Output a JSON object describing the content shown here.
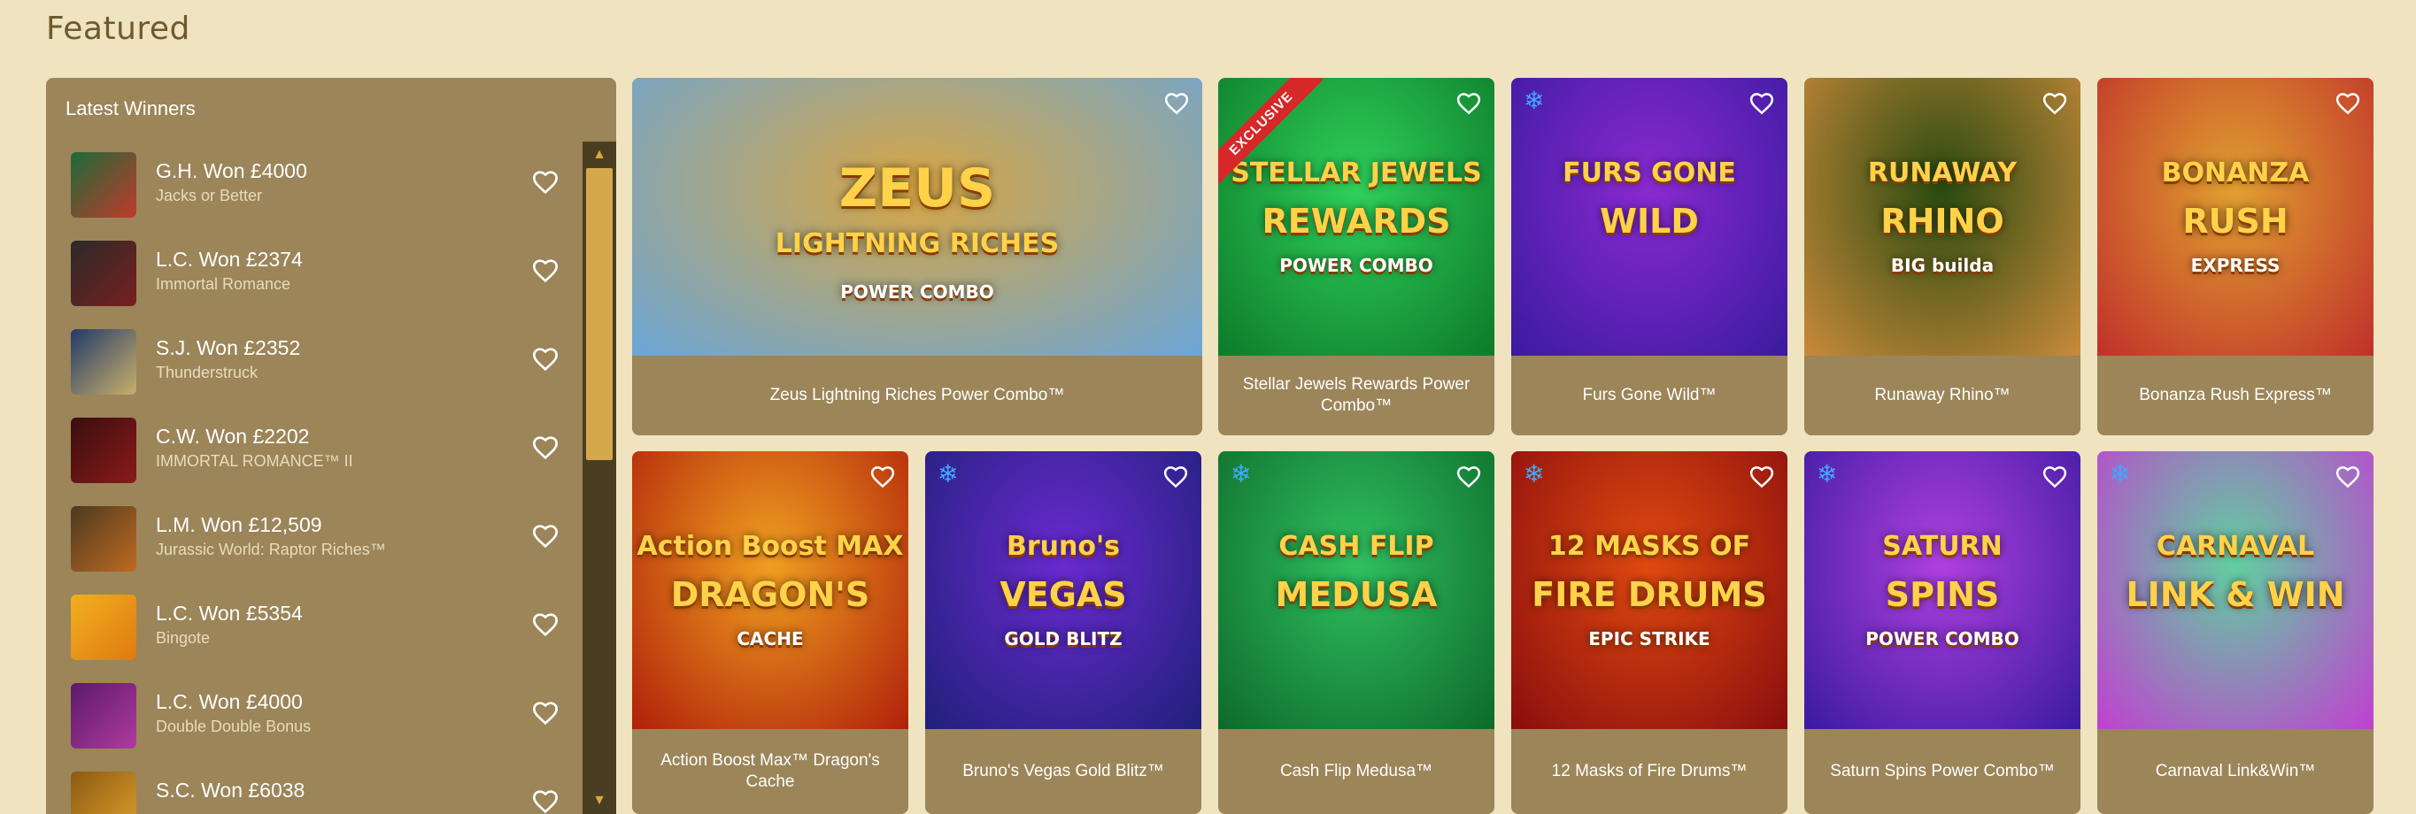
{
  "section": {
    "title": "Featured"
  },
  "winners": {
    "title": "Latest Winners",
    "items": [
      {
        "name": "G.H. Won £4000",
        "game": "Jacks or Better",
        "colors": [
          "#1a6b3a",
          "#c23a2a"
        ]
      },
      {
        "name": "L.C. Won £2374",
        "game": "Immortal Romance",
        "colors": [
          "#2a2a2a",
          "#7a1f1f"
        ]
      },
      {
        "name": "S.J. Won £2352",
        "game": "Thunderstruck",
        "colors": [
          "#223a6a",
          "#c9b06a"
        ]
      },
      {
        "name": "C.W. Won £2202",
        "game": "IMMORTAL ROMANCE™ II",
        "colors": [
          "#3a0e0e",
          "#8a1a1a"
        ]
      },
      {
        "name": "L.M. Won £12,509",
        "game": "Jurassic World: Raptor Riches™",
        "colors": [
          "#4a3a20",
          "#c06a20"
        ]
      },
      {
        "name": "L.C. Won £5354",
        "game": "Bingote",
        "colors": [
          "#f0b020",
          "#e07a10"
        ]
      },
      {
        "name": "L.C. Won £4000",
        "game": "Double Double Bonus",
        "colors": [
          "#5a1a6a",
          "#b03aa0"
        ]
      },
      {
        "name": "S.C. Won £6038",
        "game": "",
        "colors": [
          "#8a5a10",
          "#e0a030"
        ]
      }
    ]
  },
  "games": [
    {
      "title": "Zeus Lightning Riches Power Combo™",
      "logo": "ZEUS",
      "logo2": "LIGHTNING RICHES",
      "logo3": "POWER COMBO",
      "bg": [
        "#6aa6d8",
        "#d9a642"
      ],
      "snow": false,
      "exclusive": false
    },
    {
      "title": "Stellar Jewels Rewards Power Combo™",
      "logo": "STELLAR JEWELS",
      "logo2": "REWARDS",
      "logo3": "POWER COMBO",
      "bg": [
        "#0d7a2a",
        "#2fd05a"
      ],
      "snow": false,
      "exclusive": true,
      "exclusive_label": "EXCLUSIVE"
    },
    {
      "title": "Furs Gone Wild™",
      "logo": "FURS GONE",
      "logo2": "WILD",
      "logo3": "",
      "bg": [
        "#3a1aa0",
        "#8a2ad0"
      ],
      "snow": true,
      "exclusive": false
    },
    {
      "title": "Runaway Rhino™",
      "logo": "RUNAWAY",
      "logo2": "RHINO",
      "logo3": "BIG builda",
      "bg": [
        "#c98a3a",
        "#2a4a10"
      ],
      "snow": false,
      "exclusive": false
    },
    {
      "title": "Bonanza Rush Express™",
      "logo": "BONANZA",
      "logo2": "RUSH",
      "logo3": "EXPRESS",
      "bg": [
        "#c0302a",
        "#e0a030"
      ],
      "snow": false,
      "exclusive": false
    },
    {
      "title": "Action Boost Max™ Dragon's Cache",
      "logo": "Action Boost MAX",
      "logo2": "DRAGON'S",
      "logo3": "CACHE",
      "bg": [
        "#b0200a",
        "#f0a020"
      ],
      "snow": false,
      "exclusive": false
    },
    {
      "title": "Bruno's Vegas Gold Blitz™",
      "logo": "Bruno's",
      "logo2": "VEGAS",
      "logo3": "GOLD BLITZ",
      "bg": [
        "#20207a",
        "#6a2ad0"
      ],
      "snow": true,
      "exclusive": false
    },
    {
      "title": "Cash Flip Medusa™",
      "logo": "CASH FLIP",
      "logo2": "MEDUSA",
      "logo3": "",
      "bg": [
        "#0d6a2a",
        "#30c060"
      ],
      "snow": true,
      "exclusive": false
    },
    {
      "title": "12 Masks of Fire Drums™",
      "logo": "12 MASKS OF",
      "logo2": "FIRE DRUMS",
      "logo3": "EPIC STRIKE",
      "bg": [
        "#8a0d0d",
        "#e04a10"
      ],
      "snow": true,
      "exclusive": false
    },
    {
      "title": "Saturn Spins Power Combo™",
      "logo": "SATURN",
      "logo2": "SPINS",
      "logo3": "POWER COMBO",
      "bg": [
        "#3a1aa0",
        "#b040e0"
      ],
      "snow": true,
      "exclusive": false
    },
    {
      "title": "Carnaval Link&Win™",
      "logo": "CARNAVAL",
      "logo2": "LINK & WIN",
      "logo3": "",
      "bg": [
        "#c040d0",
        "#60d0a0"
      ],
      "snow": true,
      "exclusive": false
    }
  ]
}
